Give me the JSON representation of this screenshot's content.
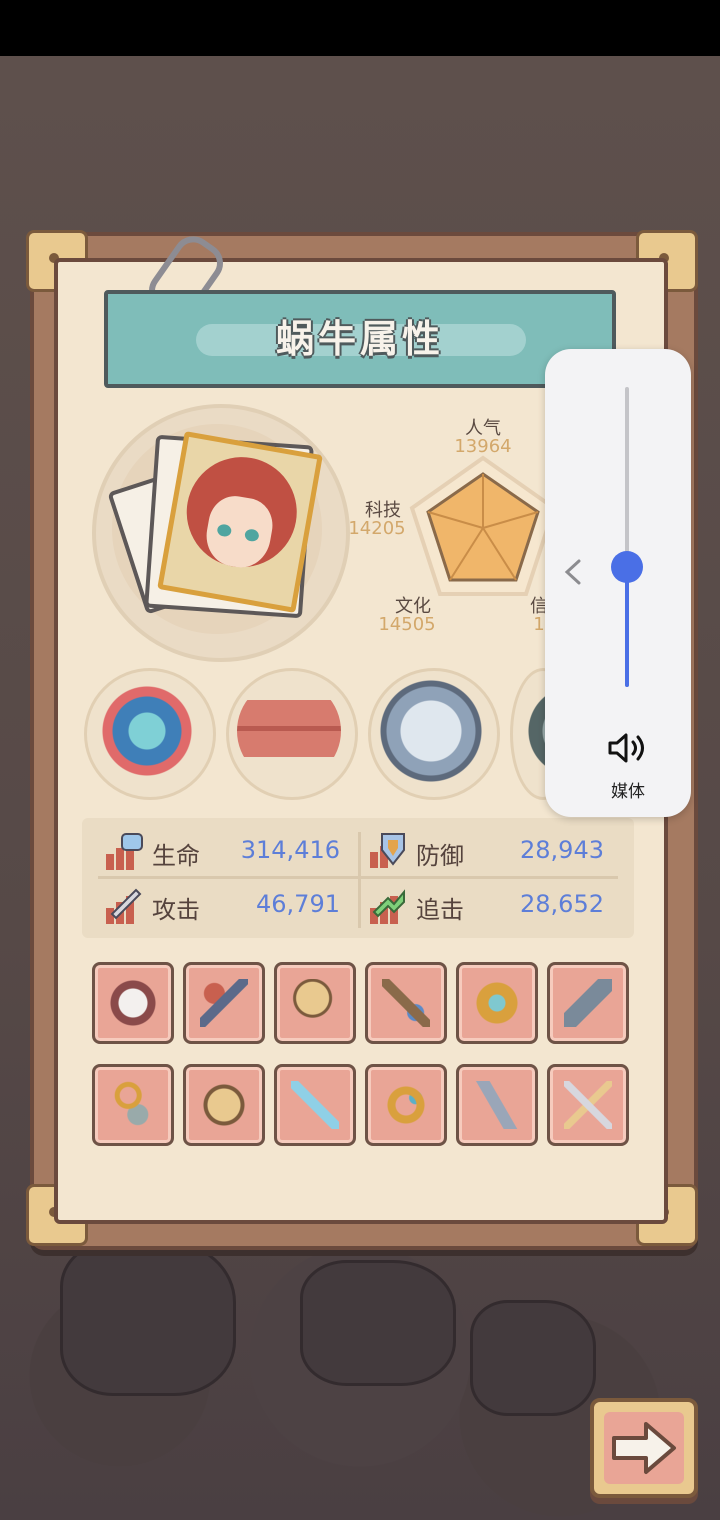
{
  "title": "蜗牛属性",
  "radar": {
    "attributes": [
      {
        "label": "人气",
        "value": "13964"
      },
      {
        "label": "科技",
        "value": "14205"
      },
      {
        "label": "文化",
        "value": "14505"
      },
      {
        "label": "信",
        "value": "1"
      }
    ]
  },
  "stats": [
    {
      "label": "生命",
      "value": "314,416",
      "icon": "health-icon"
    },
    {
      "label": "防御",
      "value": "28,943",
      "icon": "defense-icon"
    },
    {
      "label": "攻击",
      "value": "46,791",
      "icon": "attack-icon"
    },
    {
      "label": "追击",
      "value": "28,652",
      "icon": "pursuit-icon"
    }
  ],
  "circle_items": [
    "monster-relic-icon",
    "brick-stack-icon",
    "compass-icon",
    "partial-item-icon"
  ],
  "equipment": [
    "armor-icon",
    "scepter-icon",
    "mace-icon",
    "crossbow-icon",
    "gauntlet-icon",
    "blaster-icon",
    "hook-icon",
    "helmet-icon",
    "sword-icon",
    "ring-icon",
    "dagger-icon",
    "twin-blades-icon"
  ],
  "volume": {
    "label": "媒体",
    "level": 0.4
  },
  "colors": {
    "accent": "#4a6fe6",
    "stat_value": "#5d7ed8",
    "radar_value": "#d3a86b",
    "slot_bg": "#e9a596"
  }
}
